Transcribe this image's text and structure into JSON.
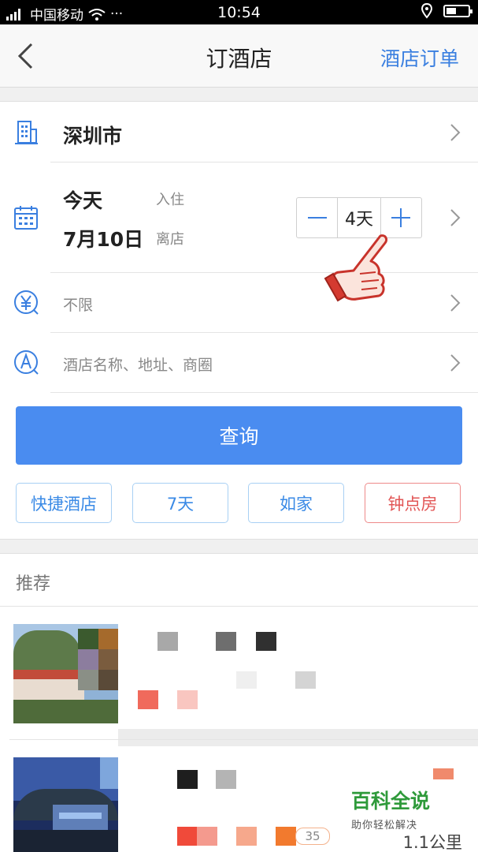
{
  "status_bar": {
    "carrier": "中国移动",
    "dots": "···",
    "time": "10:54"
  },
  "nav": {
    "title": "订酒店",
    "orders_label": "酒店订单"
  },
  "form": {
    "city": "深圳市",
    "check_in_value": "今天",
    "check_in_label": "入住",
    "check_out_value": "7月10日",
    "check_out_label": "离店",
    "nights": "4天",
    "price_value": "不限",
    "keyword_placeholder": "酒店名称、地址、商圈",
    "search_label": "查询"
  },
  "quick_filters": [
    {
      "label": "快捷酒店"
    },
    {
      "label": "7天"
    },
    {
      "label": "如家"
    },
    {
      "label": "钟点房"
    }
  ],
  "recommend": {
    "title": "推荐",
    "distance": "1.1公里",
    "price_badge": "35"
  },
  "watermark": {
    "title": "百科全说",
    "subtitle": "助你轻松解决"
  },
  "colors": {
    "accent": "#4a8cf0",
    "link": "#3a7fe0",
    "alert": "#e25555",
    "watermark": "#2e9a3a"
  },
  "icons": [
    "wifi-icon",
    "location-icon",
    "battery-icon",
    "back-arrow-icon",
    "building-icon",
    "calendar-icon",
    "yuan-icon",
    "a-circle-icon",
    "chevron-right-icon",
    "minus-icon",
    "plus-icon",
    "pointing-hand-icon"
  ]
}
